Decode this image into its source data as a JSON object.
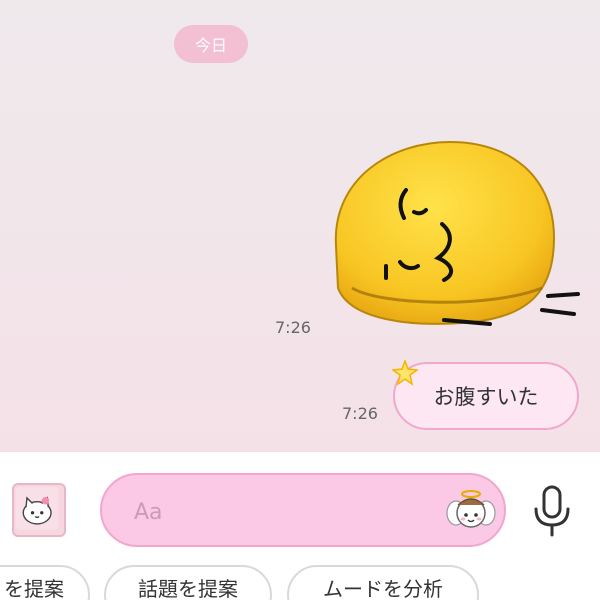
{
  "chat": {
    "date_label": "今日",
    "messages": [
      {
        "type": "sticker",
        "sticker": "yellow-blob-hungry-sticker",
        "time": "7:26"
      },
      {
        "type": "text",
        "text": "お腹すいた",
        "time": "7:26"
      }
    ]
  },
  "composer": {
    "placeholder": "Aa",
    "value": ""
  },
  "suggestions": [
    "を提案",
    "話題を提案",
    "ムードを分析"
  ],
  "icons": {
    "left": "cat-sticker-icon",
    "emoji": "angel-character-emoji-icon",
    "mic": "microphone-icon",
    "star": "star-icon"
  },
  "colors": {
    "accent_pink": "#fbc8e6",
    "bubble_pink": "#fde7f3",
    "date_badge": "#f2bfd3",
    "sticker_yellow": "#f6c62c"
  }
}
